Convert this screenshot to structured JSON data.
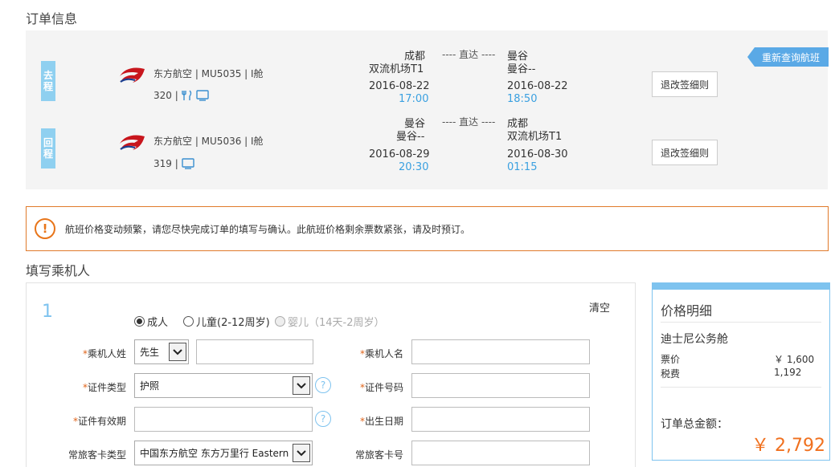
{
  "order_info": {
    "title": "订单信息",
    "requery_label": "重新查询航班",
    "outbound": {
      "direction": [
        "去",
        "程"
      ],
      "airline": "东方航空 | MU5035 | I舱",
      "aircraft": "320 |",
      "icons": [
        "meal-icon",
        "entertainment-icon"
      ],
      "dep_city": "成都",
      "dep_airport": "双流机场T1",
      "direct": "---- 直达 ----",
      "arr_city": "曼谷",
      "arr_airport": "曼谷--",
      "dep_date": "2016-08-22",
      "dep_time": "17:00",
      "arr_date": "2016-08-22",
      "arr_time": "18:50",
      "rule_label": "退改签细则"
    },
    "return": {
      "direction": [
        "回",
        "程"
      ],
      "airline": "东方航空 | MU5036 | I舱",
      "aircraft": "319 |",
      "icons": [
        "entertainment-icon"
      ],
      "dep_city": "曼谷",
      "dep_airport": "曼谷--",
      "direct": "---- 直达 ----",
      "arr_city": "成都",
      "arr_airport": "双流机场T1",
      "dep_date": "2016-08-29",
      "dep_time": "20:30",
      "arr_date": "2016-08-30",
      "arr_time": "01:15",
      "rule_label": "退改签细则"
    }
  },
  "notice": {
    "icon": "!",
    "text": "航班价格变动频繁，请您尽快完成订单的填写与确认。此航班价格剩余票数紧张，请及时预订。"
  },
  "passenger": {
    "title": "填写乘机人",
    "index": "1",
    "clear_label": "清空",
    "types": [
      {
        "label": "成人",
        "selected": true,
        "disabled": false
      },
      {
        "label": "儿童(2-12周岁)",
        "selected": false,
        "disabled": false
      },
      {
        "label": "婴儿（14天-2周岁）",
        "selected": false,
        "disabled": true
      }
    ],
    "required_mark": "*",
    "surname_label": "乘机人姓",
    "title_select": "先生",
    "given_name_label": "乘机人名",
    "id_type_label": "证件类型",
    "id_type_value": "护照",
    "id_number_label": "证件号码",
    "id_expiry_label": "证件有效期",
    "birth_date_label": "出生日期",
    "ff_type_label": "常旅客卡类型",
    "ff_type_value": "中国东方航空 东方万里行 Eastern M",
    "ff_number_label": "常旅客卡号",
    "help_glyph": "?"
  },
  "price": {
    "title": "价格明细",
    "cabin": "迪士尼公务舱",
    "fare_label": "票价",
    "fare_value": "￥ 1,600",
    "tax_label": "税费",
    "tax_value": "1,192",
    "total_label": "订单总金额：",
    "total_value": "￥ 2,792"
  },
  "colors": {
    "accent": "#5aa9e6",
    "tag": "#8fd0f0",
    "time": "#3aa0e0",
    "warning": "#e8751a",
    "total": "#f0701e"
  }
}
